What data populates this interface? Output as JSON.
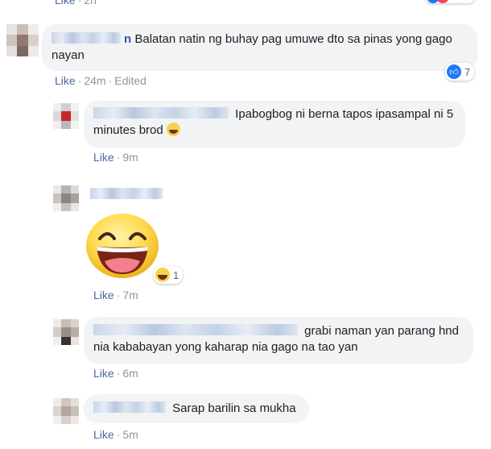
{
  "top_actions": {
    "like": "Like",
    "time": "2h"
  },
  "comments": [
    {
      "name_suffix": "n",
      "text": "Balatan natin ng buhay pag umuwe dto sa pinas yong gago nayan",
      "like": "Like",
      "time": "24m",
      "edited": "Edited",
      "reaction_count": "7"
    },
    {
      "text": "Ipabogbog ni berna tapos ipasampal ni 5 minutes brod",
      "like": "Like",
      "time": "9m"
    },
    {
      "like": "Like",
      "time": "7m",
      "reaction_count": "1"
    },
    {
      "text": "grabi naman yan parang hnd nia kababayan yong kaharap nia gago na tao yan",
      "like": "Like",
      "time": "6m"
    },
    {
      "text": "Sarap barilin sa mukha",
      "like": "Like",
      "time": "5m"
    }
  ],
  "icons": {
    "like_reaction": "thumbs-up-icon",
    "haha_reaction": "haha-icon",
    "sticker": "laughing-face-sticker",
    "smiley": "grinning-emoji"
  },
  "colors": {
    "bubble": "#f2f3f5",
    "link": "#4b67a1",
    "meta": "#90949c",
    "like_blue": "#2078f4"
  }
}
